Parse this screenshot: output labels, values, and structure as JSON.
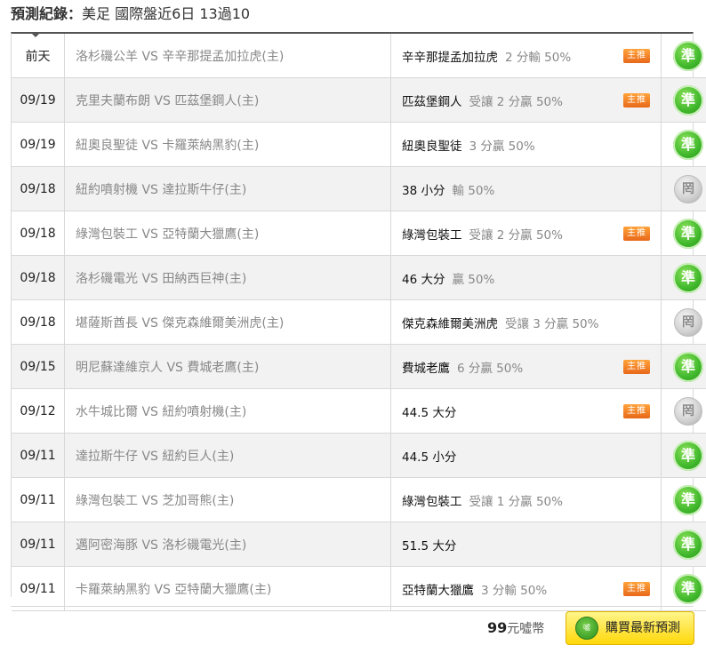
{
  "header": {
    "label": "預測紀錄：",
    "subtitle": "美足 國際盤近6日 13過10"
  },
  "rows": [
    {
      "date": "前天",
      "match": "洛杉磯公羊 VS 辛辛那提孟加拉虎(主)",
      "pick_team": "辛辛那提孟加拉虎",
      "pick_odds": "2 分輸 50%",
      "badge": "主推",
      "result": "準",
      "result_type": "win"
    },
    {
      "date": "09/19",
      "match": "克里夫蘭布朗 VS 匹茲堡鋼人(主)",
      "pick_team": "匹茲堡鋼人",
      "pick_odds": "受讓 2 分贏 50%",
      "badge": "主推",
      "result": "準",
      "result_type": "win"
    },
    {
      "date": "09/19",
      "match": "紐奧良聖徒 VS 卡羅萊納黑豹(主)",
      "pick_team": "紐奧良聖徒",
      "pick_odds": "3 分贏 50%",
      "badge": "",
      "result": "準",
      "result_type": "win"
    },
    {
      "date": "09/18",
      "match": "紐約噴射機 VS 達拉斯牛仔(主)",
      "pick_team": "38 小分",
      "pick_odds": "輸 50%",
      "badge": "",
      "result": "罔",
      "result_type": "push"
    },
    {
      "date": "09/18",
      "match": "綠灣包裝工 VS 亞特蘭大獵鷹(主)",
      "pick_team": "綠灣包裝工",
      "pick_odds": "受讓 2 分贏 50%",
      "badge": "主推",
      "result": "準",
      "result_type": "win"
    },
    {
      "date": "09/18",
      "match": "洛杉磯電光 VS 田納西巨神(主)",
      "pick_team": "46 大分",
      "pick_odds": "贏 50%",
      "badge": "",
      "result": "準",
      "result_type": "win"
    },
    {
      "date": "09/18",
      "match": "堪薩斯酋長 VS 傑克森維爾美洲虎(主)",
      "pick_team": "傑克森維爾美洲虎",
      "pick_odds": "受讓 3 分贏 50%",
      "badge": "",
      "result": "罔",
      "result_type": "push"
    },
    {
      "date": "09/15",
      "match": "明尼蘇達維京人 VS 費城老鷹(主)",
      "pick_team": "費城老鷹",
      "pick_odds": "6 分贏 50%",
      "badge": "主推",
      "result": "準",
      "result_type": "win"
    },
    {
      "date": "09/12",
      "match": "水牛城比爾 VS 紐約噴射機(主)",
      "pick_team": "44.5 大分",
      "pick_odds": "",
      "badge": "主推",
      "result": "罔",
      "result_type": "push"
    },
    {
      "date": "09/11",
      "match": "達拉斯牛仔 VS 紐約巨人(主)",
      "pick_team": "44.5 小分",
      "pick_odds": "",
      "badge": "",
      "result": "準",
      "result_type": "win"
    },
    {
      "date": "09/11",
      "match": "綠灣包裝工 VS 芝加哥熊(主)",
      "pick_team": "綠灣包裝工",
      "pick_odds": "受讓 1 分贏 50%",
      "badge": "",
      "result": "準",
      "result_type": "win"
    },
    {
      "date": "09/11",
      "match": "邁阿密海豚 VS 洛杉磯電光(主)",
      "pick_team": "51.5 大分",
      "pick_odds": "",
      "badge": "",
      "result": "準",
      "result_type": "win"
    },
    {
      "date": "09/11",
      "match": "卡羅萊納黑豹 VS 亞特蘭大獵鷹(主)",
      "pick_team": "亞特蘭大獵鷹",
      "pick_odds": "3 分輸 50%",
      "badge": "主推",
      "result": "準",
      "result_type": "win"
    }
  ],
  "footer": {
    "price_amount": "99",
    "price_unit": "元噓幣",
    "buy_label": "購買最新預測",
    "buy_icon_text": "噓"
  },
  "colors": {
    "win": "#41b82c",
    "badge": "#f07d22",
    "button": "#ffd80a"
  }
}
